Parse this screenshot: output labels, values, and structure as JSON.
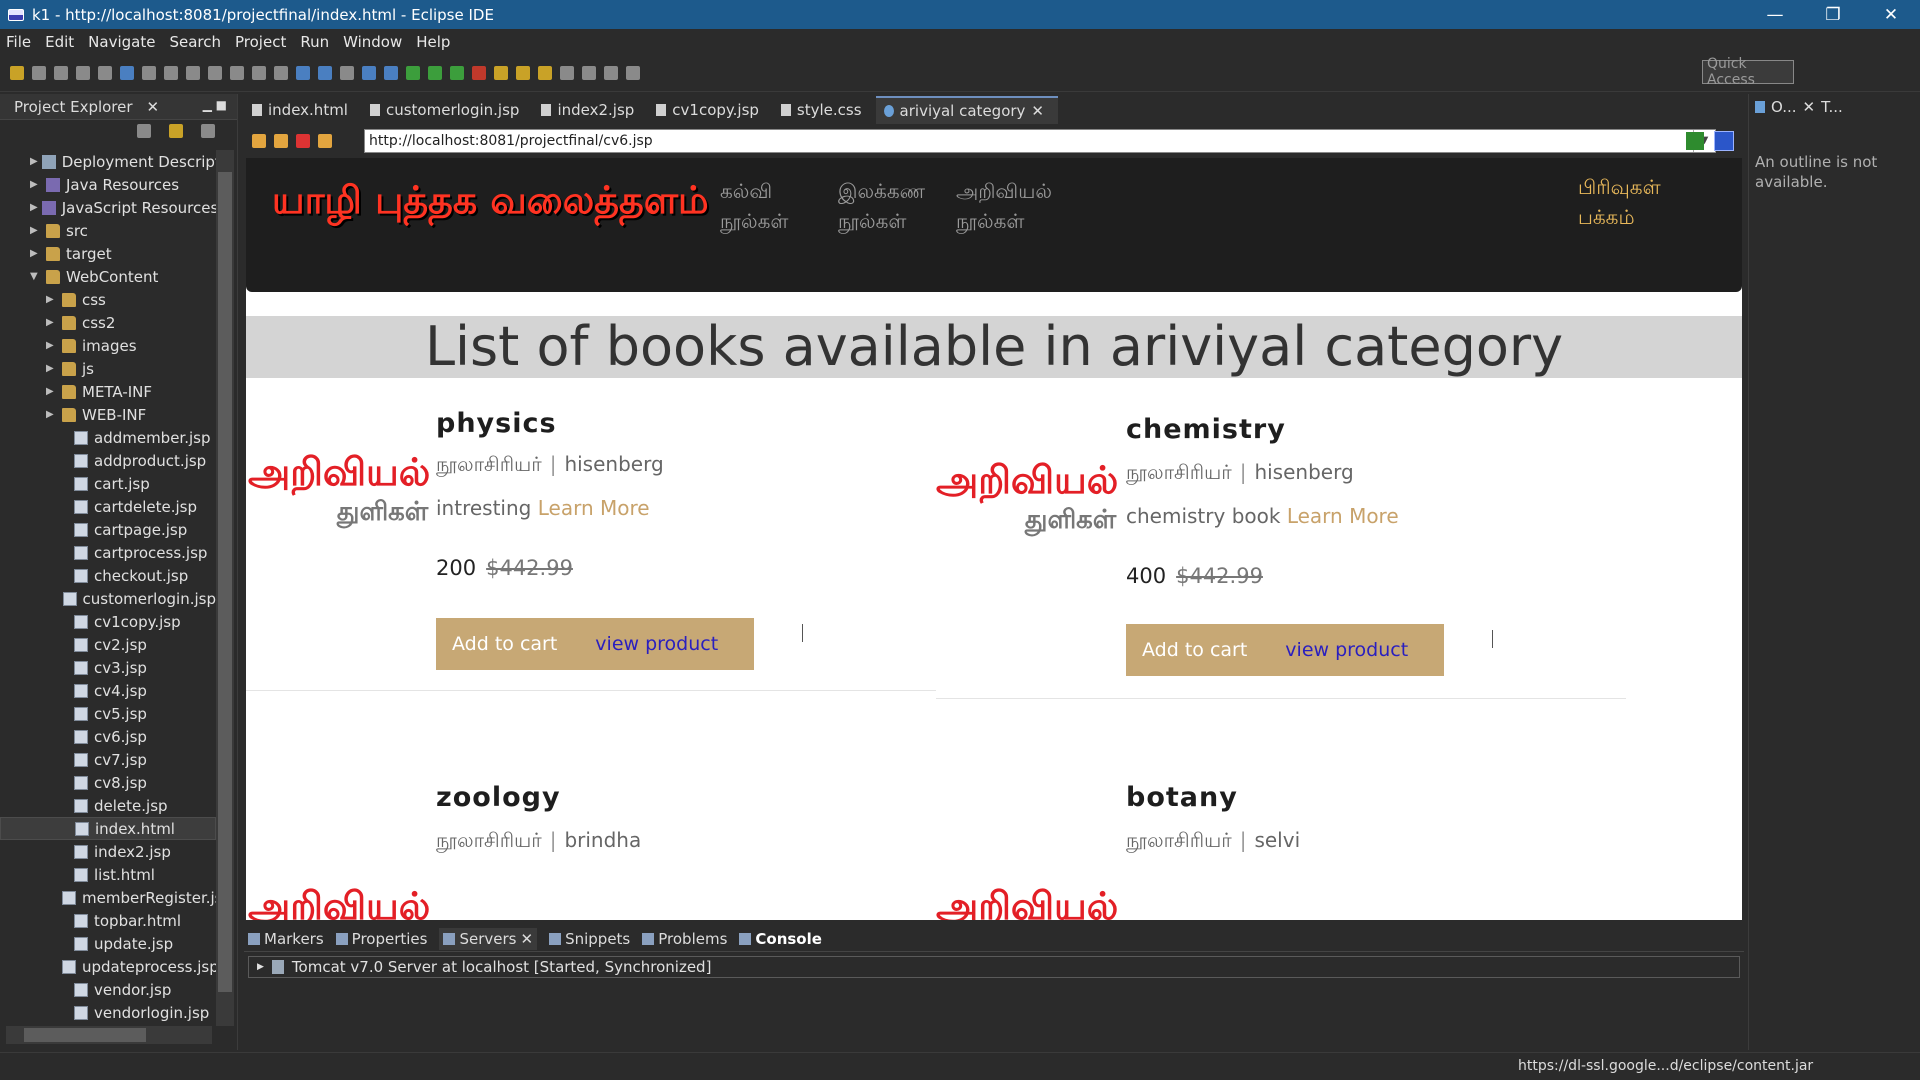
{
  "window": {
    "title": "k1 - http://localhost:8081/projectfinal/index.html - Eclipse IDE",
    "minimize": "—",
    "restore": "❐",
    "close": "✕"
  },
  "menu": [
    "File",
    "Edit",
    "Navigate",
    "Search",
    "Project",
    "Run",
    "Window",
    "Help"
  ],
  "toolbar": {
    "quick_access": "Quick Access"
  },
  "project_explorer": {
    "title": "Project Explorer",
    "items": [
      {
        "label": "Deployment Descripto",
        "indent": 1,
        "type": "desc",
        "expander": "▶"
      },
      {
        "label": "Java Resources",
        "indent": 1,
        "type": "lib",
        "expander": "▶"
      },
      {
        "label": "JavaScript Resources",
        "indent": 1,
        "type": "lib",
        "expander": "▶"
      },
      {
        "label": "src",
        "indent": 1,
        "type": "folder",
        "expander": "▶"
      },
      {
        "label": "target",
        "indent": 1,
        "type": "folder",
        "expander": "▶"
      },
      {
        "label": "WebContent",
        "indent": 1,
        "type": "folder",
        "expander": "▼"
      },
      {
        "label": "css",
        "indent": 2,
        "type": "folder",
        "expander": "▶"
      },
      {
        "label": "css2",
        "indent": 2,
        "type": "folder",
        "expander": "▶"
      },
      {
        "label": "images",
        "indent": 2,
        "type": "folder",
        "expander": "▶"
      },
      {
        "label": "js",
        "indent": 2,
        "type": "folder",
        "expander": "▶"
      },
      {
        "label": "META-INF",
        "indent": 2,
        "type": "folder",
        "expander": "▶"
      },
      {
        "label": "WEB-INF",
        "indent": 2,
        "type": "folder",
        "expander": "▶"
      },
      {
        "label": "addmember.jsp",
        "indent": 3,
        "type": "file"
      },
      {
        "label": "addproduct.jsp",
        "indent": 3,
        "type": "file"
      },
      {
        "label": "cart.jsp",
        "indent": 3,
        "type": "file"
      },
      {
        "label": "cartdelete.jsp",
        "indent": 3,
        "type": "file"
      },
      {
        "label": "cartpage.jsp",
        "indent": 3,
        "type": "file"
      },
      {
        "label": "cartprocess.jsp",
        "indent": 3,
        "type": "file"
      },
      {
        "label": "checkout.jsp",
        "indent": 3,
        "type": "file"
      },
      {
        "label": "customerlogin.jsp",
        "indent": 3,
        "type": "file"
      },
      {
        "label": "cv1copy.jsp",
        "indent": 3,
        "type": "file"
      },
      {
        "label": "cv2.jsp",
        "indent": 3,
        "type": "file"
      },
      {
        "label": "cv3.jsp",
        "indent": 3,
        "type": "file"
      },
      {
        "label": "cv4.jsp",
        "indent": 3,
        "type": "file"
      },
      {
        "label": "cv5.jsp",
        "indent": 3,
        "type": "file"
      },
      {
        "label": "cv6.jsp",
        "indent": 3,
        "type": "file"
      },
      {
        "label": "cv7.jsp",
        "indent": 3,
        "type": "file"
      },
      {
        "label": "cv8.jsp",
        "indent": 3,
        "type": "file"
      },
      {
        "label": "delete.jsp",
        "indent": 3,
        "type": "file"
      },
      {
        "label": "index.html",
        "indent": 3,
        "type": "file",
        "selected": true
      },
      {
        "label": "index2.jsp",
        "indent": 3,
        "type": "file"
      },
      {
        "label": "list.html",
        "indent": 3,
        "type": "file"
      },
      {
        "label": "memberRegister.jsp",
        "indent": 3,
        "type": "file"
      },
      {
        "label": "topbar.html",
        "indent": 3,
        "type": "file"
      },
      {
        "label": "update.jsp",
        "indent": 3,
        "type": "file"
      },
      {
        "label": "updateprocess.jsp",
        "indent": 3,
        "type": "file"
      },
      {
        "label": "vendor.jsp",
        "indent": 3,
        "type": "file"
      },
      {
        "label": "vendorlogin.jsp",
        "indent": 3,
        "type": "file"
      }
    ]
  },
  "editor": {
    "tabs": [
      {
        "label": "index.html"
      },
      {
        "label": "customerlogin.jsp"
      },
      {
        "label": "index2.jsp"
      },
      {
        "label": "cv1copy.jsp"
      },
      {
        "label": "style.css"
      },
      {
        "label": "ariviyal category",
        "active": true
      }
    ],
    "url": "http://localhost:8081/projectfinal/cv6.jsp"
  },
  "site": {
    "logo": "யாழி புத்தக வலைத்தளம்",
    "nav": [
      {
        "line1": "கல்வி",
        "line2": "நூல்கள்"
      },
      {
        "line1": "இலக்கண",
        "line2": "நூல்கள்"
      },
      {
        "line1": "அறிவியல்",
        "line2": "நூல்கள்"
      }
    ],
    "right_link": {
      "line1": "பிரிவுகள்",
      "line2": "பக்கம்"
    },
    "heading": "List of books available in ariviyal category",
    "products": [
      {
        "image_line1": "அறிவியல்",
        "image_line2": "துளிகள்",
        "name": "physics",
        "author_label": "நூலாசிரியர்",
        "author": "hisenberg",
        "desc": "intresting",
        "learn_more": "Learn More",
        "price": "200",
        "old_price": "$442.99",
        "add_to_cart": "Add to cart",
        "view_product": "view product"
      },
      {
        "image_line1": "அறிவியல்",
        "image_line2": "துளிகள்",
        "name": "chemistry",
        "author_label": "நூலாசிரியர்",
        "author": "hisenberg",
        "desc": "chemistry book",
        "learn_more": "Learn More",
        "price": "400",
        "old_price": "$442.99",
        "add_to_cart": "Add to cart",
        "view_product": "view product"
      },
      {
        "image_line1": "அறிவியல்",
        "name": "zoology",
        "author_label": "நூலாசிரியர்",
        "author": "brindha"
      },
      {
        "image_line1": "அறிவியல்",
        "name": "botany",
        "author_label": "நூலாசிரியர்",
        "author": "selvi"
      }
    ]
  },
  "bottom_panel": {
    "tabs": [
      "Markers",
      "Properties",
      "Servers",
      "Snippets",
      "Problems",
      "Console"
    ],
    "server_row": "Tomcat v7.0 Server at localhost  [Started, Synchronized]"
  },
  "outline": {
    "tab1": "O...",
    "tab2": "T...",
    "message": "An outline is not available."
  },
  "status": {
    "text": "https://dl-ssl.google...d/eclipse/content.jar"
  },
  "colors": {
    "titlebar": "#1d5a8c",
    "logo_red": "#ff3322",
    "button_tan": "#c7a875",
    "learn_more": "#c8a26a",
    "view_link": "#2a1fbf"
  }
}
